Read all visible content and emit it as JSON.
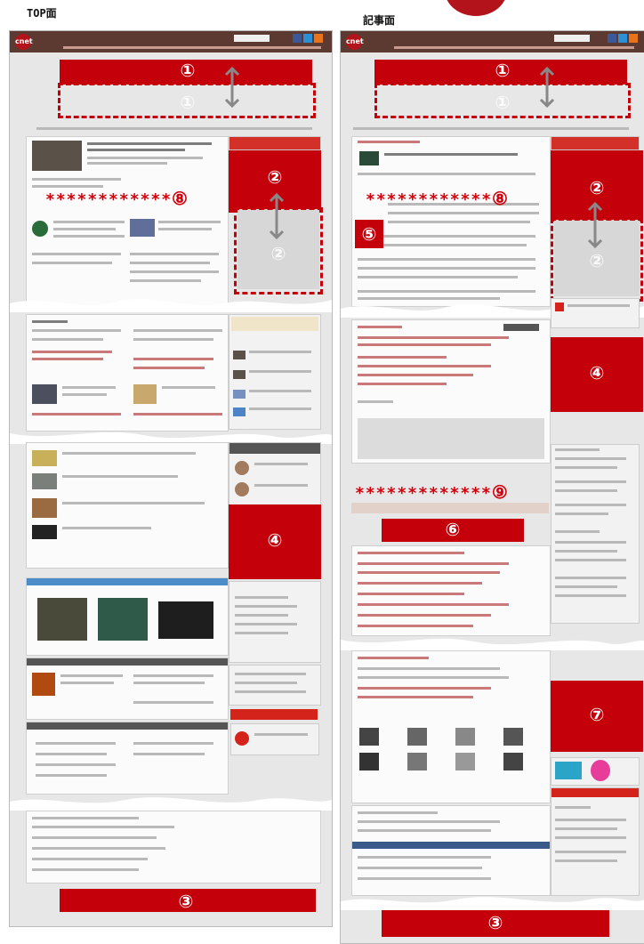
{
  "titles": {
    "left": "TOP面",
    "right": "記事面"
  },
  "markers": {
    "n1": "①",
    "n2": "②",
    "n3": "③",
    "n4": "④",
    "n5": "⑤",
    "n6": "⑥",
    "n7": "⑦",
    "n8": "⑧",
    "n9": "⑨"
  },
  "asterisks": {
    "left": "************",
    "right_8": "************",
    "right_9": "*************"
  },
  "colors": {
    "accent": "#c4000b",
    "page_bg": "#e7e7e7",
    "header": "#5c3a32"
  }
}
